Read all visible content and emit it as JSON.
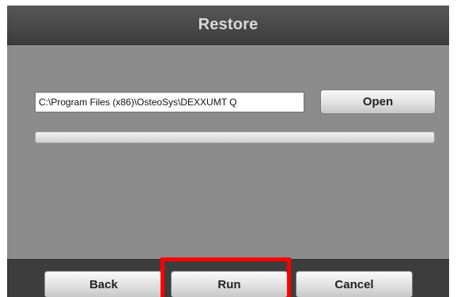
{
  "dialog": {
    "title": "Restore"
  },
  "path_field": {
    "value": "C:\\Program Files (x86)\\OsteoSys\\DEXXUMT Q"
  },
  "open_button": {
    "label": "Open"
  },
  "progress": {
    "fraction": 0,
    "fill_color": "#3a7bd5"
  },
  "footer": {
    "back_label": "Back",
    "run_label": "Run",
    "cancel_label": "Cancel"
  },
  "highlight": {
    "target": "run-button",
    "color": "#ff0000"
  }
}
